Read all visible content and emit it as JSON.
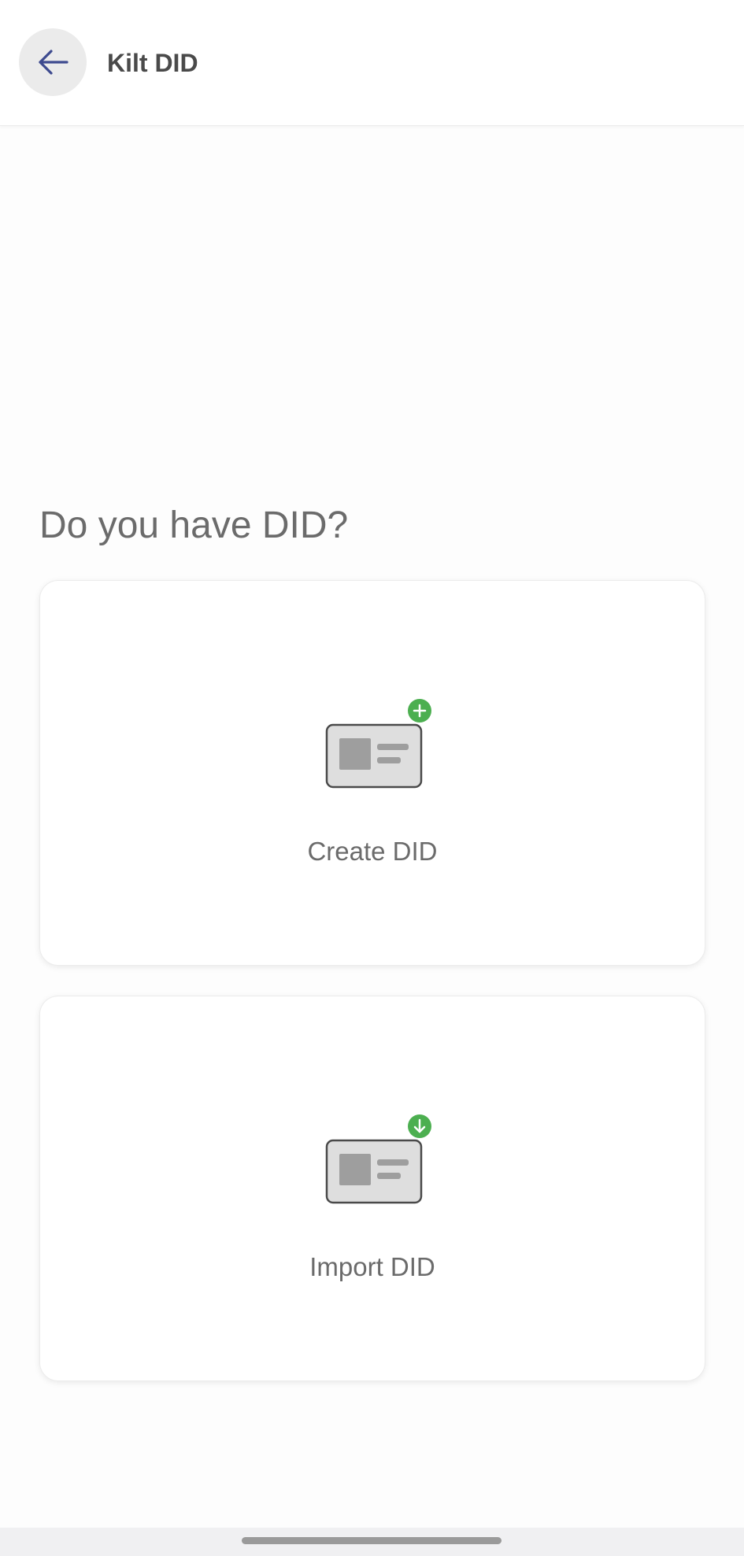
{
  "header": {
    "title": "Kilt DID",
    "back_icon": "arrow-left-icon"
  },
  "main": {
    "question": "Do you have DID?",
    "options": [
      {
        "label": "Create DID",
        "icon": "id-card-add-icon",
        "badge_color": "#4caf50"
      },
      {
        "label": "Import DID",
        "icon": "id-card-import-icon",
        "badge_color": "#4caf50"
      }
    ]
  },
  "colors": {
    "accent": "#3d4a8f",
    "text": "#6b6b6b",
    "badge": "#4caf50"
  }
}
